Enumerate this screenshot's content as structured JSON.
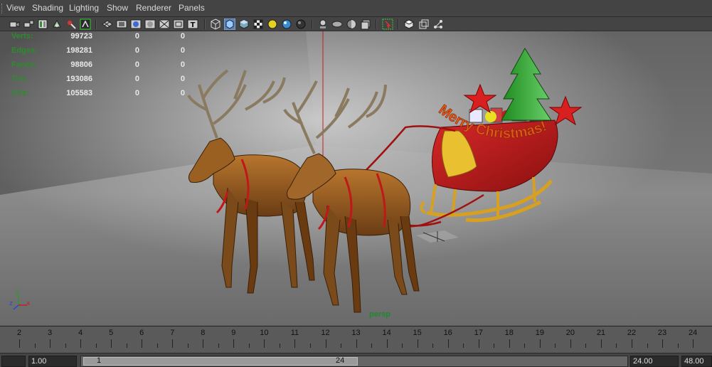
{
  "menu": {
    "items": [
      {
        "label": "View"
      },
      {
        "label": "Shading"
      },
      {
        "label": "Lighting"
      },
      {
        "label": "Show"
      },
      {
        "label": "Renderer"
      },
      {
        "label": "Panels"
      }
    ]
  },
  "toolbar": {
    "icons": [
      "select-camera-icon",
      "lock-camera-icon",
      "camera-attributes-icon",
      "bookmark-icon",
      "image-plane-icon",
      "2d-pan-zoom-icon",
      "grease-pencil-icon",
      "grid-icon",
      "film-gate-icon",
      "resolution-gate-icon",
      "gate-mask-icon",
      "field-chart-icon",
      "safe-action-icon",
      "safe-title-icon",
      "wireframe-icon",
      "smooth-shade-icon",
      "default-material-icon",
      "textured-icon",
      "use-all-lights-icon",
      "shadows-icon",
      "ambient-occlusion-icon",
      "motion-blur-icon",
      "anti-aliasing-icon",
      "depth-of-field-icon",
      "isolate-select-icon",
      "xray-icon",
      "xray-joints-icon",
      "xray-components-icon"
    ]
  },
  "hud": {
    "rows": [
      {
        "label": "Verts:",
        "v1": "99723",
        "v2": "0",
        "v3": "0"
      },
      {
        "label": "Edges:",
        "v1": "198281",
        "v2": "0",
        "v3": "0"
      },
      {
        "label": "Faces:",
        "v1": "98806",
        "v2": "0",
        "v3": "0"
      },
      {
        "label": "Tris:",
        "v1": "193086",
        "v2": "0",
        "v3": "0"
      },
      {
        "label": "UVs:",
        "v1": "105583",
        "v2": "0",
        "v3": "0"
      }
    ],
    "camera": "persp",
    "axes": {
      "y": "y",
      "x": "x",
      "z": "z"
    }
  },
  "scene": {
    "banner_text": "Merry Christmas!"
  },
  "timeline": {
    "ticks": [
      "2",
      "3",
      "4",
      "5",
      "6",
      "7",
      "8",
      "9",
      "10",
      "11",
      "12",
      "13",
      "14",
      "15",
      "16",
      "17",
      "18",
      "19",
      "20",
      "21",
      "22",
      "23",
      "24"
    ]
  },
  "range": {
    "start_time": "1.00",
    "playback_start": "1",
    "playback_end": "24",
    "end_time": "24.00",
    "anim_end": "48.00"
  },
  "colors": {
    "viewport_bg": "#8a8a8a",
    "hud_label": "#2e8b2e",
    "sleigh_red": "#b01818",
    "sleigh_gold": "#d8a020"
  }
}
